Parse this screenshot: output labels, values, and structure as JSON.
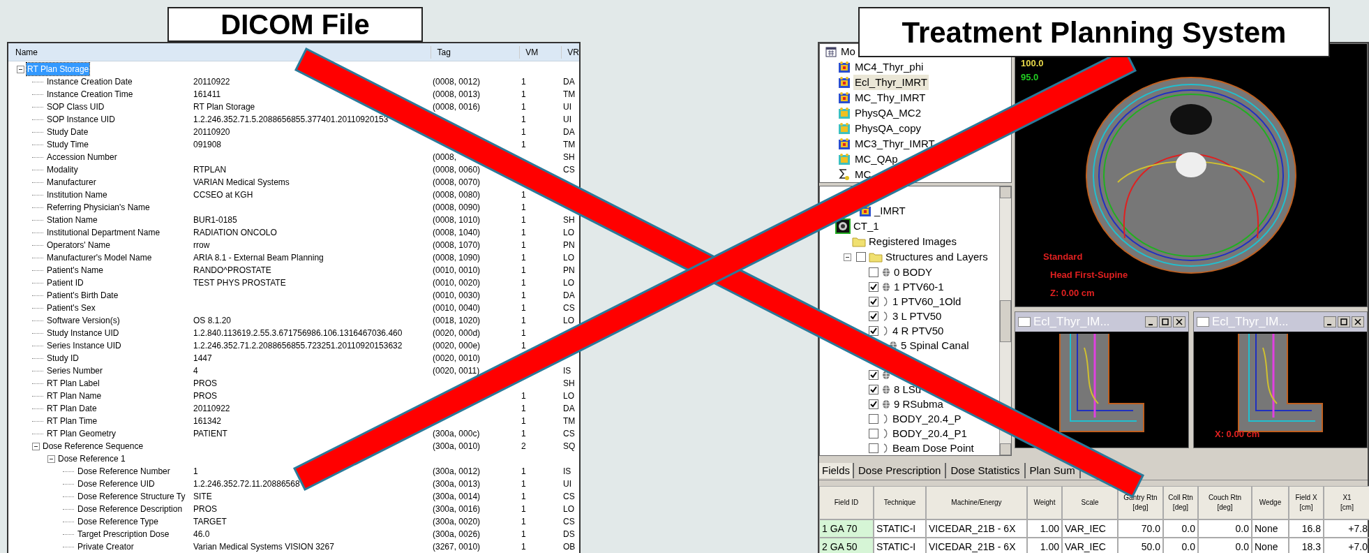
{
  "dicom_panel": {
    "title": "DICOM File",
    "columns": [
      "Name",
      "Tag",
      "VM",
      "VR"
    ],
    "tree": [
      {
        "name": "RT Plan Storage",
        "selected": true,
        "expanded": true,
        "children": [
          {
            "name": "Instance Creation Date",
            "value": "20110922",
            "tag": "(0008, 0012)",
            "vm": "1",
            "vr": "DA"
          },
          {
            "name": "Instance Creation Time",
            "value": "161411",
            "tag": "(0008, 0013)",
            "vm": "1",
            "vr": "TM"
          },
          {
            "name": "SOP Class UID",
            "value": "RT Plan Storage",
            "tag": "(0008, 0016)",
            "vm": "1",
            "vr": "UI"
          },
          {
            "name": "SOP Instance UID",
            "value": "1.2.246.352.71.5.2088656855.377401.20110920153",
            "vm": "1",
            "vr": "UI"
          },
          {
            "name": "Study Date",
            "value": "20110920",
            "vm": "1",
            "vr": "DA"
          },
          {
            "name": "Study Time",
            "value": "091908",
            "vm": "1",
            "vr": "TM"
          },
          {
            "name": "Accession Number",
            "tag": "(0008,",
            "vr": "SH"
          },
          {
            "name": "Modality",
            "value": "RTPLAN",
            "tag": "(0008, 0060)",
            "vr": "CS"
          },
          {
            "name": "Manufacturer",
            "value": "VARIAN Medical Systems",
            "tag": "(0008, 0070)"
          },
          {
            "name": "Institution Name",
            "value": "CCSEO at KGH",
            "tag": "(0008, 0080)",
            "vm": "1"
          },
          {
            "name": "Referring Physician's Name",
            "tag": "(0008, 0090)",
            "vm": "1"
          },
          {
            "name": "Station Name",
            "value": "BUR1-0185",
            "tag": "(0008, 1010)",
            "vm": "1",
            "vr": "SH"
          },
          {
            "name": "Institutional Department Name",
            "value": "RADIATION ONCOLO",
            "tag": "(0008, 1040)",
            "vm": "1",
            "vr": "LO"
          },
          {
            "name": "Operators' Name",
            "value": "rrow",
            "tag": "(0008, 1070)",
            "vm": "1",
            "vr": "PN"
          },
          {
            "name": "Manufacturer's Model Name",
            "value": "ARIA 8.1 - External Beam Planning",
            "tag": "(0008, 1090)",
            "vm": "1",
            "vr": "LO"
          },
          {
            "name": "Patient's Name",
            "value": "RANDO^PROSTATE",
            "tag": "(0010, 0010)",
            "vm": "1",
            "vr": "PN"
          },
          {
            "name": "Patient ID",
            "value": "TEST PHYS PROSTATE",
            "tag": "(0010, 0020)",
            "vm": "1",
            "vr": "LO"
          },
          {
            "name": "Patient's Birth Date",
            "tag": "(0010, 0030)",
            "vm": "1",
            "vr": "DA"
          },
          {
            "name": "Patient's Sex",
            "tag": "(0010, 0040)",
            "vm": "1",
            "vr": "CS"
          },
          {
            "name": "Software Version(s)",
            "value": "OS 8.1.20",
            "tag": "(0018, 1020)",
            "vm": "1",
            "vr": "LO"
          },
          {
            "name": "Study Instance UID",
            "value": "1.2.840.113619.2.55.3.671756986.106.1316467036.460",
            "tag": "(0020, 000d)",
            "vm": "1"
          },
          {
            "name": "Series Instance UID",
            "value": "1.2.246.352.71.2.2088656855.723251.20110920153632",
            "tag": "(0020, 000e)",
            "vm": "1"
          },
          {
            "name": "Study ID",
            "value": "1447",
            "tag": "(0020, 0010)"
          },
          {
            "name": "Series Number",
            "value": "4",
            "tag": "(0020, 0011)",
            "vr": "IS"
          },
          {
            "name": "RT Plan Label",
            "value": "PROS",
            "vr": "SH"
          },
          {
            "name": "RT Plan Name",
            "value": "PROS",
            "vm": "1",
            "vr": "LO"
          },
          {
            "name": "RT Plan Date",
            "value": "20110922",
            "vm": "1",
            "vr": "DA"
          },
          {
            "name": "RT Plan Time",
            "value": "161342",
            "vm": "1",
            "vr": "TM"
          },
          {
            "name": "RT Plan Geometry",
            "value": "PATIENT",
            "tag": "(300a, 000c)",
            "vm": "1",
            "vr": "CS"
          },
          {
            "name": "Dose Reference Sequence",
            "tag": "(300a, 0010)",
            "vm": "2",
            "vr": "SQ",
            "expanded": true,
            "children": [
              {
                "name": "Dose Reference 1",
                "expanded": true,
                "children": [
                  {
                    "name": "Dose Reference Number",
                    "value": "1",
                    "tag": "(300a, 0012)",
                    "vm": "1",
                    "vr": "IS"
                  },
                  {
                    "name": "Dose Reference UID",
                    "value": "1.2.246.352.72.11.20886568",
                    "tag": "(300a, 0013)",
                    "vm": "1",
                    "vr": "UI"
                  },
                  {
                    "name": "Dose Reference Structure Ty",
                    "value": "SITE",
                    "tag": "(300a, 0014)",
                    "vm": "1",
                    "vr": "CS"
                  },
                  {
                    "name": "Dose Reference Description",
                    "value": "PROS",
                    "tag": "(300a, 0016)",
                    "vm": "1",
                    "vr": "LO"
                  },
                  {
                    "name": "Dose Reference Type",
                    "value": "TARGET",
                    "tag": "(300a, 0020)",
                    "vm": "1",
                    "vr": "CS"
                  },
                  {
                    "name": "Target Prescription Dose",
                    "value": "46.0",
                    "tag": "(300a, 0026)",
                    "vm": "1",
                    "vr": "DS"
                  },
                  {
                    "name": "Private Creator",
                    "value": "Varian Medical Systems VISION 3267",
                    "tag": "(3267, 0010)",
                    "vm": "1",
                    "vr": "OB"
                  }
                ]
              }
            ]
          }
        ]
      }
    ]
  },
  "tps_panel": {
    "title": "Treatment Planning System",
    "plans": [
      {
        "label": "Mo",
        "kind": "calendar",
        "selected": false
      },
      {
        "label": "MC4_Thyr_phi",
        "kind": "plan",
        "selected": false
      },
      {
        "label": "Ecl_Thyr_IMRT",
        "kind": "plan",
        "selected": true
      },
      {
        "label": "MC_Thy_IMRT",
        "kind": "plan",
        "selected": false
      },
      {
        "label": "PhysQA_MC2",
        "kind": "qa",
        "selected": false
      },
      {
        "label": "PhysQA_copy",
        "kind": "qa",
        "selected": false
      },
      {
        "label": "MC3_Thyr_IMRT",
        "kind": "plan",
        "selected": false
      },
      {
        "label": "MC_QAp",
        "kind": "qa",
        "selected": false
      },
      {
        "label": "MC",
        "kind": "sum",
        "selected": false
      }
    ],
    "tree": [
      {
        "label": "_IMRT",
        "kind": "plan"
      },
      {
        "label": "CT_1",
        "kind": "image"
      },
      {
        "label": "Registered Images",
        "kind": "folder"
      },
      {
        "label": "Structures and Layers",
        "kind": "folder",
        "expanded": true,
        "checked": false,
        "children": [
          {
            "label": "0 BODY",
            "kind": "volume",
            "checked": false
          },
          {
            "label": "1 PTV60-1",
            "kind": "volume",
            "checked": true
          },
          {
            "label": "1 PTV60_1Old",
            "kind": "contour",
            "checked": true
          },
          {
            "label": "3 L PTV50",
            "kind": "contour",
            "checked": true
          },
          {
            "label": "4 R PTV50",
            "kind": "contour",
            "checked": true
          },
          {
            "label": "5 Spinal Canal",
            "kind": "volume"
          },
          {
            "kind": "none"
          },
          {
            "kind": "volume",
            "checked": true
          },
          {
            "label": "8 LSu",
            "kind": "volume",
            "checked": true
          },
          {
            "label": "9 RSubma",
            "kind": "volume",
            "checked": true
          },
          {
            "label": "BODY_20.4_P",
            "kind": "contour",
            "checked": false
          },
          {
            "label": "BODY_20.4_P1",
            "kind": "contour",
            "checked": false
          },
          {
            "label": "Beam Dose Point",
            "kind": "contour",
            "checked": false
          }
        ]
      }
    ],
    "axial_view": {
      "isodose_labels": [
        {
          "text": "100.0",
          "color": "#e8d84a"
        },
        {
          "text": "95.0",
          "color": "#22cc22"
        }
      ],
      "orientation": "Standard",
      "position": "Head First-Supine",
      "coordinate": "Z: 0.00 cm"
    },
    "small_views": [
      {
        "title": "Ecl_Thyr_IM..."
      },
      {
        "title": "Ecl_Thyr_IM...",
        "coordinate": "X: 0.00 cm"
      }
    ],
    "tabs": [
      {
        "label": "Fields",
        "selected": true
      },
      {
        "label": "Dose Prescription",
        "selected": false
      },
      {
        "label": "Dose Statistics",
        "selected": false
      },
      {
        "label": "Plan Sum",
        "selected": false
      }
    ],
    "fields_table": {
      "columns": [
        "Field ID",
        "Technique",
        "Machine/Energy",
        "Weight",
        "Scale",
        "Gantry Rtn\n[deg]",
        "Coll Rtn\n[deg]",
        "Couch Rtn\n[deg]",
        "Wedge",
        "Field X\n[cm]",
        "X1\n[cm]"
      ],
      "rows": [
        [
          "1 GA 70",
          "STATIC-I",
          "VICEDAR_21B - 6X",
          "1.00",
          "VAR_IEC",
          "70.0",
          "0.0",
          "0.0",
          "None",
          "16.8",
          "+7.8"
        ],
        [
          "2 GA 50",
          "STATIC-I",
          "VICEDAR_21B - 6X",
          "1.00",
          "VAR_IEC",
          "50.0",
          "0.0",
          "0.0",
          "None",
          "18.3",
          "+7.0"
        ]
      ]
    }
  }
}
